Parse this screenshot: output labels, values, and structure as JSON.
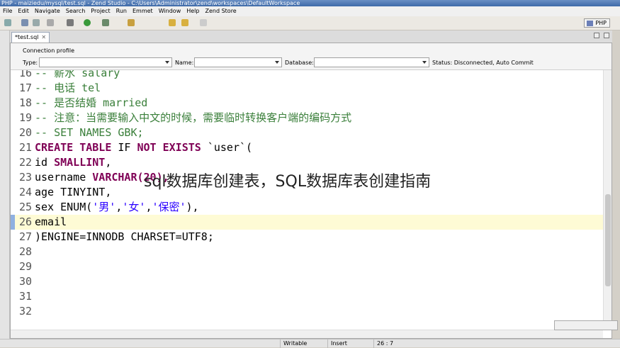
{
  "window": {
    "title": "PHP - maiziedu/mysql/test.sql - Zend Studio - C:\\Users\\Administrator\\zend\\workspaces\\DefaultWorkspace"
  },
  "menu": [
    "File",
    "Edit",
    "Navigate",
    "Search",
    "Project",
    "Run",
    "Emmet",
    "Window",
    "Help",
    "Zend Store"
  ],
  "perspective": {
    "label": "PHP"
  },
  "editor_tab": {
    "label": "*test.sql",
    "close": "✕"
  },
  "connection": {
    "title": "Connection profile",
    "type_label": "Type:",
    "name_label": "Name:",
    "database_label": "Database:",
    "status": "Status: Disconnected, Auto Commit"
  },
  "code_lines": [
    {
      "n": "16",
      "parts": [
        {
          "t": "-- 薪水 salary",
          "c": "cm"
        }
      ]
    },
    {
      "n": "17",
      "parts": [
        {
          "t": "-- 电话 tel",
          "c": "cm"
        }
      ]
    },
    {
      "n": "18",
      "parts": [
        {
          "t": "-- 是否结婚 married",
          "c": "cm"
        }
      ]
    },
    {
      "n": "19",
      "parts": [
        {
          "t": "-- 注意：当需要输入中文的时候，需要临时转换客户端的编码方式",
          "c": "cm"
        }
      ]
    },
    {
      "n": "20",
      "parts": [
        {
          "t": "-- SET NAMES GBK;",
          "c": "cm"
        }
      ]
    },
    {
      "n": "21",
      "parts": [
        {
          "t": "CREATE TABLE",
          "c": "kw"
        },
        {
          "t": " IF ",
          "c": ""
        },
        {
          "t": "NOT EXISTS",
          "c": "kw"
        },
        {
          "t": " `user`(",
          "c": ""
        }
      ]
    },
    {
      "n": "22",
      "parts": [
        {
          "t": "id ",
          "c": ""
        },
        {
          "t": "SMALLINT",
          "c": "ty"
        },
        {
          "t": ",",
          "c": ""
        }
      ]
    },
    {
      "n": "23",
      "parts": [
        {
          "t": "username ",
          "c": ""
        },
        {
          "t": "VARCHAR(20),",
          "c": "ty"
        }
      ]
    },
    {
      "n": "24",
      "parts": [
        {
          "t": "age TINYINT,",
          "c": ""
        }
      ]
    },
    {
      "n": "25",
      "parts": [
        {
          "t": "sex ENUM(",
          "c": ""
        },
        {
          "t": "'男'",
          "c": "str"
        },
        {
          "t": ",",
          "c": ""
        },
        {
          "t": "'女'",
          "c": "str"
        },
        {
          "t": ",",
          "c": ""
        },
        {
          "t": "'保密'",
          "c": "str"
        },
        {
          "t": "),",
          "c": ""
        }
      ]
    },
    {
      "n": "26",
      "parts": [
        {
          "t": "email",
          "c": ""
        }
      ]
    },
    {
      "n": "27",
      "parts": [
        {
          "t": ")ENGINE=INNODB CHARSET=UTF8;",
          "c": ""
        }
      ]
    },
    {
      "n": "28",
      "parts": []
    },
    {
      "n": "29",
      "parts": []
    },
    {
      "n": "30",
      "parts": []
    },
    {
      "n": "31",
      "parts": []
    },
    {
      "n": "32",
      "parts": []
    }
  ],
  "current_line": "26",
  "overlay_text": "sql数据库创建表，SQL数据库表创建指南",
  "status": {
    "writable": "Writable",
    "insert": "Insert",
    "position": "26 : 7"
  }
}
